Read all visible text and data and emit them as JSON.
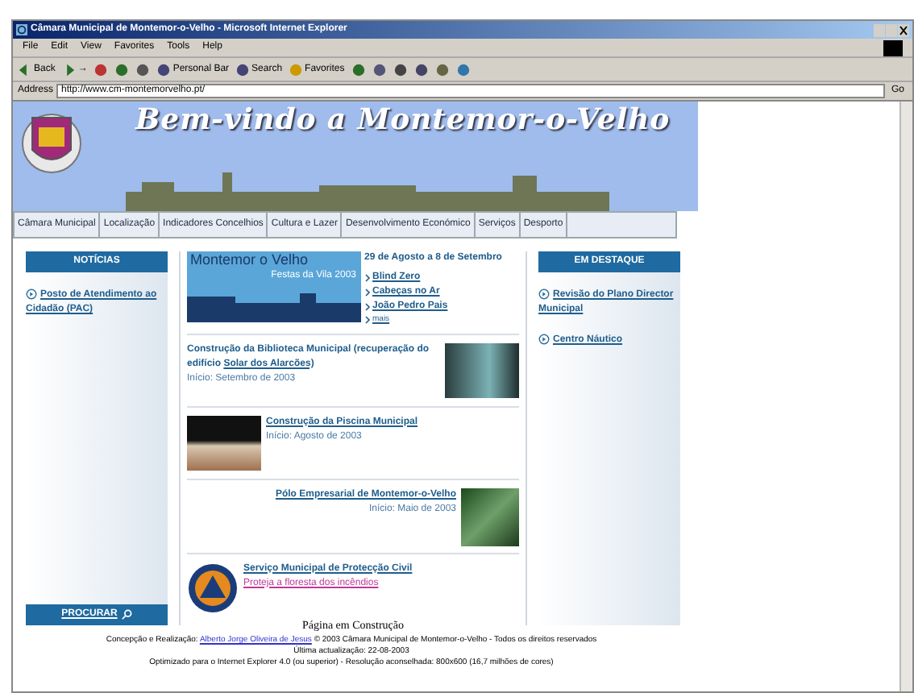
{
  "window": {
    "title": "Câmara Municipal de Montemor-o-Velho - Microsoft Internet Explorer"
  },
  "menu": [
    "File",
    "Edit",
    "View",
    "Favorites",
    "Tools",
    "Help"
  ],
  "toolbar": [
    {
      "kind": "back",
      "label": "Back"
    },
    {
      "kind": "forward",
      "label": "→"
    },
    {
      "kind": "stop"
    },
    {
      "kind": "refresh"
    },
    {
      "kind": "home"
    },
    {
      "kind": "personal",
      "label": "Personal Bar"
    },
    {
      "kind": "search",
      "label": "Search"
    },
    {
      "kind": "favorites",
      "label": "Favorites"
    },
    {
      "kind": "history"
    },
    {
      "kind": "mail"
    },
    {
      "kind": "print"
    },
    {
      "kind": "edit"
    },
    {
      "kind": "discuss"
    },
    {
      "kind": "messenger"
    }
  ],
  "address": {
    "label": "Address",
    "value": "http://www.cm-montemorvelho.pt/",
    "go": "Go"
  },
  "banner": {
    "title": "Bem-vindo a Montemor-o-Velho"
  },
  "nav": [
    "Câmara Municipal",
    "Localização",
    "Indicadores Concelhios",
    "Cultura e Lazer",
    "Desenvolvimento Económico",
    "Serviços",
    "Desporto"
  ],
  "left": {
    "heading": "NOTÍCIAS",
    "links": [
      "Posto de Atendimento ao Cidadão (PAC)"
    ],
    "search": "PROCURAR"
  },
  "feature": {
    "image_title": "Montemor o Velho",
    "image_subtitle": "Festas da Vila 2003",
    "date": "29 de Agosto a 8 de Setembro",
    "links": [
      "Blind Zero",
      "Cabeças no Ar",
      "João Pedro Pais"
    ],
    "more": "mais"
  },
  "news": [
    {
      "kind": "image_right",
      "title": "Construção da Biblioteca Municipal (recuperação do edifício",
      "link": "Solar dos Alarcões)",
      "date": "Início: Setembro de 2003"
    },
    {
      "kind": "image_left",
      "title": "Construção da Piscina Municipal",
      "date": "Início: Agosto de 2003"
    },
    {
      "kind": "image_right_aligned",
      "title": "Pólo Empresarial de Montemor-o-Velho",
      "date": "Início: Maio de 2003"
    },
    {
      "kind": "emblem",
      "title": "Serviço Municipal de Protecção Civil",
      "link": "Proteja a floresta dos incêndios"
    }
  ],
  "construction": "Página em Construção",
  "right": {
    "heading": "EM DESTAQUE",
    "links": [
      "Revisão do Plano Director Municipal",
      "Centro Náutico"
    ]
  },
  "footer": {
    "credit_label": "Concepção e Realização:",
    "credit_link": "Alberto Jorge Oliveira de Jesus",
    "copyright": "© 2003 Câmara Municipal de Montemor-o-Velho - Todos os direitos reservados",
    "updated": "Última actualização: 22-08-2003",
    "optimized": "Optimizado para o Internet Explorer 4.0 (ou superior) - Resolução aconselhada: 800x600 (16,7 milhões de cores)"
  }
}
